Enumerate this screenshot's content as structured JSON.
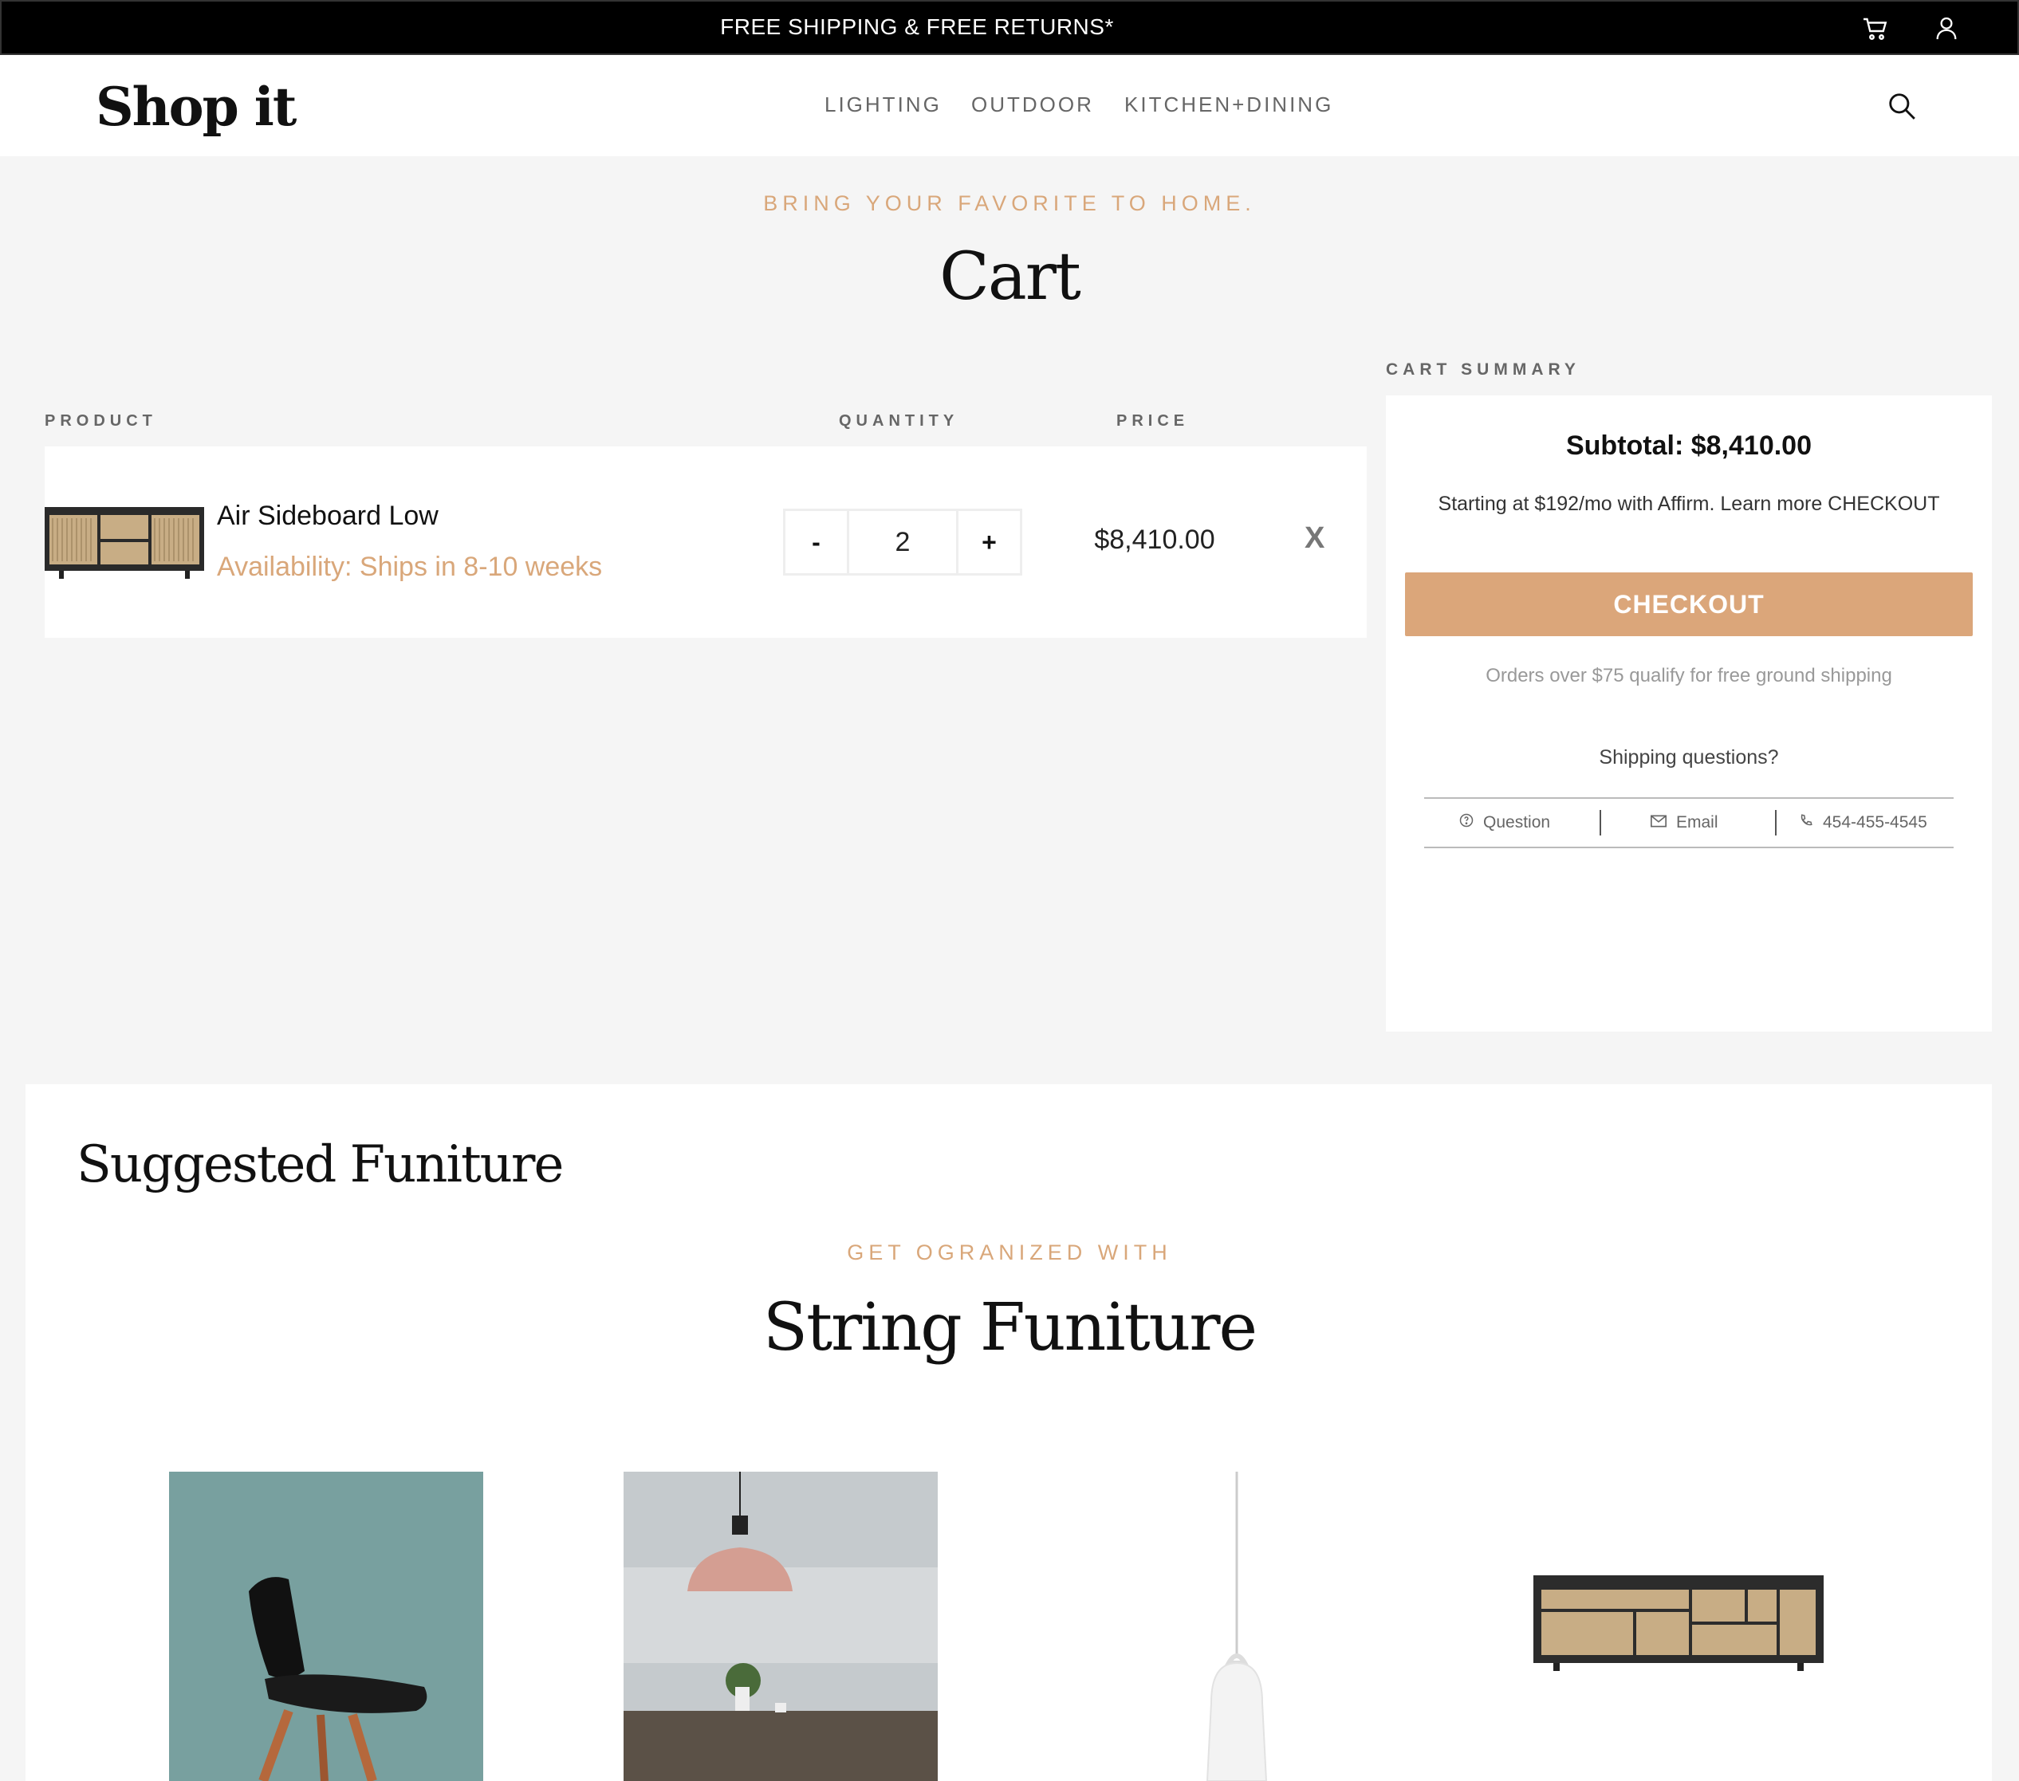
{
  "banner": {
    "text": "FREE SHIPPING & FREE RETURNS*"
  },
  "header": {
    "logo": "Shop it",
    "nav": [
      "LIGHTING",
      "OUTDOOR",
      "KITCHEN+DINING"
    ]
  },
  "hero": {
    "eyebrow": "BRING YOUR FAVORITE TO HOME.",
    "title": "Cart"
  },
  "table": {
    "headers": {
      "product": "PRODUCT",
      "quantity": "QUANTITY",
      "price": "PRICE"
    },
    "items": [
      {
        "name": "Air Sideboard Low",
        "availability": "Availability: Ships in 8-10 weeks",
        "quantity": "2",
        "minus": "-",
        "plus": "+",
        "price": "$8,410.00",
        "remove": "X"
      }
    ]
  },
  "summary": {
    "heading": "CART SUMMARY",
    "subtotal": "Subtotal:  $8,410.00",
    "affirm": "Starting at $192/mo with Affirm. Learn more CHECKOUT",
    "checkout": "CHECKOUT",
    "free_shipping": "Orders over $75 qualify for free ground shipping",
    "shipping_questions": "Shipping questions?",
    "contacts": {
      "question": "Question",
      "email": "Email",
      "phone": "454-455-4545"
    }
  },
  "suggested": {
    "title": "Suggested Funiture",
    "eyebrow": "GET OGRANIZED WITH",
    "heading": "String Funiture"
  },
  "icons": [
    "cart-icon",
    "user-icon",
    "search-icon",
    "question-icon",
    "mail-icon",
    "phone-icon"
  ],
  "colors": {
    "accent": "#dba67a",
    "banner": "#000000",
    "background": "#f5f5f5"
  }
}
